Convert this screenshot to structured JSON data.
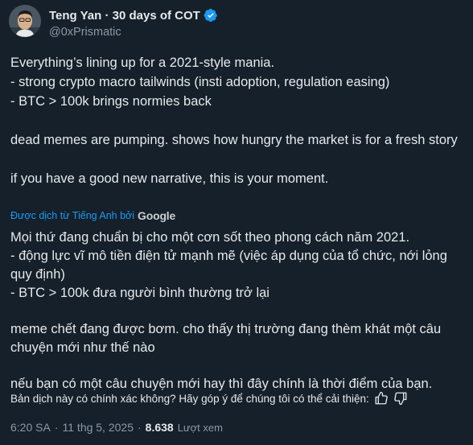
{
  "author": {
    "display_name": "Teng Yan · 30 days of COT",
    "handle": "@0xPrismatic",
    "verified_icon": "verified-badge-icon",
    "avatar_icon": "avatar-photo"
  },
  "tweet": {
    "original_paragraphs": [
      "Everything’s lining up for a 2021-style mania.",
      "- strong crypto macro tailwinds (insti adoption, regulation easing)",
      "- BTC > 100k brings normies back",
      "dead memes are pumping. shows how hungry the market is for a fresh story",
      "if you have a good new narrative, this is your moment."
    ],
    "translated_by_label": "Được dịch từ Tiếng Anh bởi",
    "translator_brand": "Google",
    "translated_paragraphs": [
      "Mọi thứ đang chuẩn bị cho một cơn sốt theo phong cách năm 2021.",
      "- động lực vĩ mô tiền điện tử mạnh mẽ (việc áp dụng của tổ chức, nới lỏng quy định)",
      "- BTC > 100k đưa người bình thường trở lại",
      "meme chết đang được bơm. cho thấy thị trường đang thèm khát một câu chuyện mới như thế nào",
      "nếu bạn có một câu chuyện mới hay thì đây chính là thời điểm của bạn."
    ],
    "feedback_question": "Bản dịch này có chính xác không? Hãy góp ý để chúng tôi có thể cải thiện:",
    "time": "6:20 SA",
    "separator": "·",
    "date": "11 thg 5, 2025",
    "view_count": "8.638",
    "view_label": "Lượt xem"
  },
  "colors": {
    "background": "#15202b",
    "text": "#e7e9ea",
    "secondary": "#8b98a5",
    "link": "#1d9bf0"
  }
}
